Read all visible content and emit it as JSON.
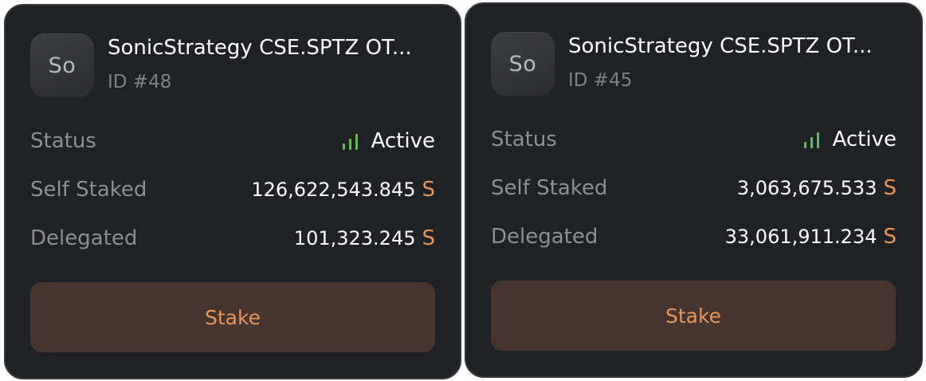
{
  "colors": {
    "card_bg": "#202124",
    "accent_orange": "#e8945a",
    "status_green": "#5fbf4f",
    "button_bg": "#45352e"
  },
  "validators": [
    {
      "avatar": "So",
      "name": "SonicStrategy CSE.SPTZ OT...",
      "id": "ID #48",
      "status_label": "Status",
      "status_value": "Active",
      "status_icon": "signal-bars-icon",
      "self_staked_label": "Self Staked",
      "self_staked_value": "126,622,543.845",
      "self_staked_unit": "S",
      "delegated_label": "Delegated",
      "delegated_value": "101,323.245",
      "delegated_unit": "S",
      "button_label": "Stake"
    },
    {
      "avatar": "So",
      "name": "SonicStrategy CSE.SPTZ OT...",
      "id": "ID #45",
      "status_label": "Status",
      "status_value": "Active",
      "status_icon": "signal-bars-icon",
      "self_staked_label": "Self Staked",
      "self_staked_value": "3,063,675.533",
      "self_staked_unit": "S",
      "delegated_label": "Delegated",
      "delegated_value": "33,061,911.234",
      "delegated_unit": "S",
      "button_label": "Stake"
    }
  ]
}
